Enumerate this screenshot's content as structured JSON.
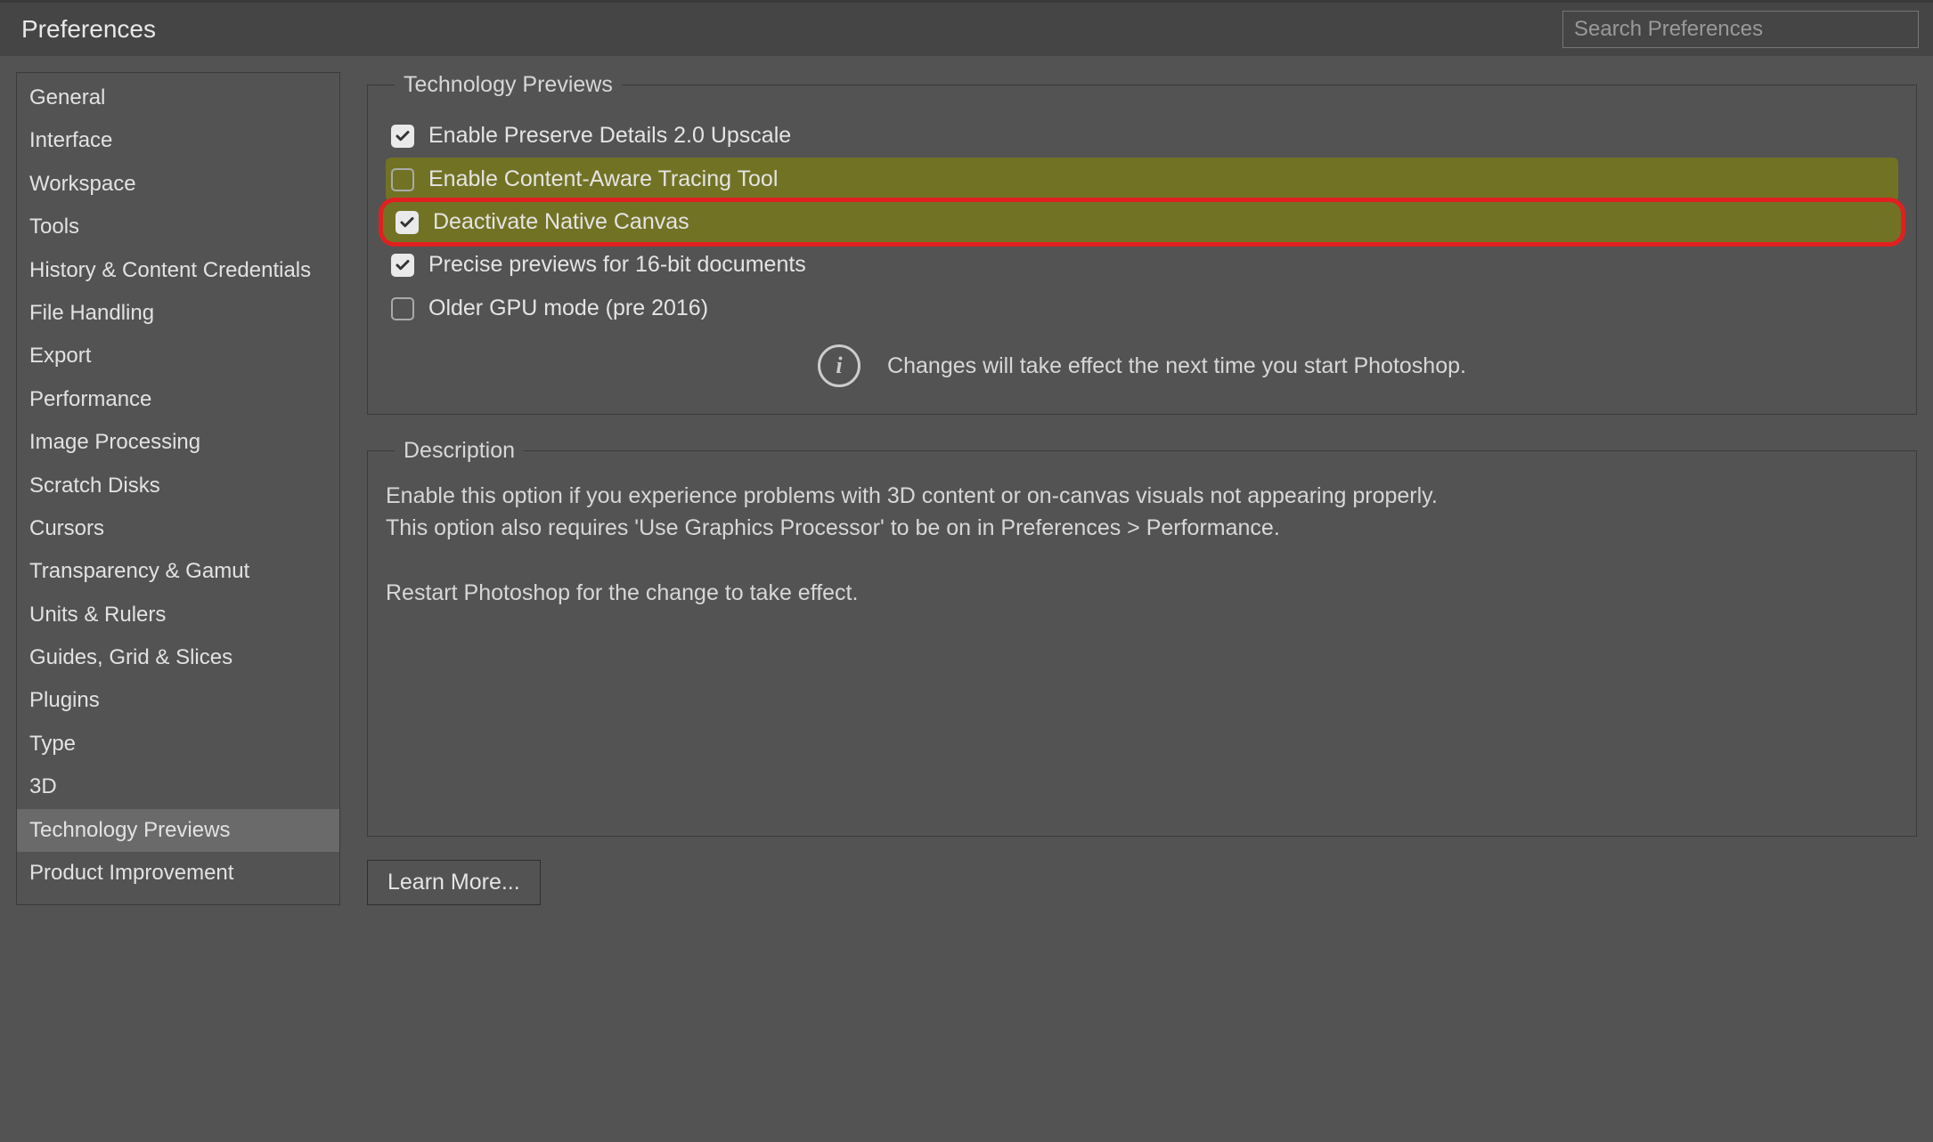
{
  "header": {
    "title": "Preferences",
    "search_placeholder": "Search Preferences"
  },
  "sidebar": {
    "items": [
      {
        "label": "General",
        "selected": false
      },
      {
        "label": "Interface",
        "selected": false
      },
      {
        "label": "Workspace",
        "selected": false
      },
      {
        "label": "Tools",
        "selected": false
      },
      {
        "label": "History & Content Credentials",
        "selected": false
      },
      {
        "label": "File Handling",
        "selected": false
      },
      {
        "label": "Export",
        "selected": false
      },
      {
        "label": "Performance",
        "selected": false
      },
      {
        "label": "Image Processing",
        "selected": false
      },
      {
        "label": "Scratch Disks",
        "selected": false
      },
      {
        "label": "Cursors",
        "selected": false
      },
      {
        "label": "Transparency & Gamut",
        "selected": false
      },
      {
        "label": "Units & Rulers",
        "selected": false
      },
      {
        "label": "Guides, Grid & Slices",
        "selected": false
      },
      {
        "label": "Plugins",
        "selected": false
      },
      {
        "label": "Type",
        "selected": false
      },
      {
        "label": "3D",
        "selected": false
      },
      {
        "label": "Technology Previews",
        "selected": true
      },
      {
        "label": "Product Improvement",
        "selected": false
      }
    ]
  },
  "previews": {
    "group_title": "Technology Previews",
    "options": [
      {
        "label": "Enable Preserve Details 2.0 Upscale",
        "checked": true,
        "hl": "none"
      },
      {
        "label": "Enable Content-Aware Tracing Tool",
        "checked": false,
        "hl": "yellow"
      },
      {
        "label": "Deactivate Native Canvas",
        "checked": true,
        "hl": "red"
      },
      {
        "label": "Precise previews for 16-bit documents",
        "checked": true,
        "hl": "none"
      },
      {
        "label": "Older GPU mode (pre 2016)",
        "checked": false,
        "hl": "none"
      }
    ],
    "info_text": "Changes will take effect the next time you start Photoshop."
  },
  "description": {
    "group_title": "Description",
    "body": "Enable this option if you experience problems with 3D content or on-canvas visuals not appearing properly.\nThis option also requires 'Use Graphics Processor' to be on in Preferences > Performance.\n\nRestart Photoshop for the change to take effect."
  },
  "learn_more_label": "Learn More..."
}
